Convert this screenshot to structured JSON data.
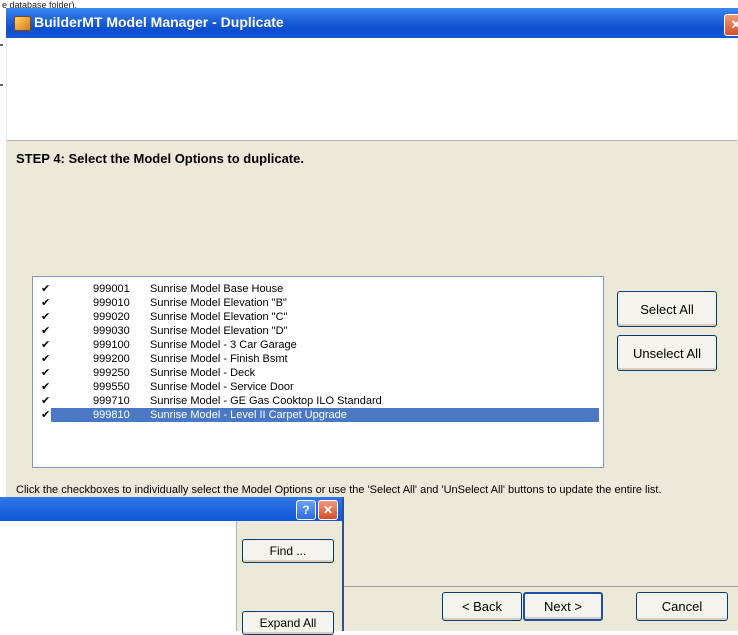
{
  "background_window": {
    "strip_text": "e database folder)."
  },
  "dialog": {
    "title": "BuilderMT Model Manager - Duplicate",
    "close_glyph": "✕",
    "step_title": "STEP 4: Select the Model Options to duplicate.",
    "options": [
      {
        "checked": "✔",
        "code": "999001",
        "name": "Sunrise Model Base House"
      },
      {
        "checked": "✔",
        "code": "999010",
        "name": "Sunrise Model Elevation \"B\""
      },
      {
        "checked": "✔",
        "code": "999020",
        "name": "Sunrise Model Elevation \"C\""
      },
      {
        "checked": "✔",
        "code": "999030",
        "name": "Sunrise Model Elevation \"D\""
      },
      {
        "checked": "✔",
        "code": "999100",
        "name": "Sunrise Model - 3 Car Garage"
      },
      {
        "checked": "✔",
        "code": "999200",
        "name": "Sunrise Model - Finish Bsmt"
      },
      {
        "checked": "✔",
        "code": "999250",
        "name": "Sunrise Model - Deck"
      },
      {
        "checked": "✔",
        "code": "999550",
        "name": "Sunrise Model - Service Door"
      },
      {
        "checked": "✔",
        "code": "999710",
        "name": "Sunrise Model - GE Gas Cooktop ILO Standard"
      },
      {
        "checked": "✔",
        "code": "999810",
        "name": "Sunrise Model - Level II Carpet Upgrade",
        "selected": true
      }
    ],
    "select_all_label": "Select All",
    "unselect_all_label": "Unselect All",
    "hint": "Click the checkboxes to individually select the Model Options or use the 'Select All' and 'UnSelect All' buttons to update the entire list.",
    "back_label": "< Back",
    "next_label": "Next >",
    "cancel_label": "Cancel"
  },
  "overlay_window": {
    "help_glyph": "?",
    "close_glyph": "✕",
    "find_label": "Find ...",
    "expand_all_label": "Expand All"
  }
}
